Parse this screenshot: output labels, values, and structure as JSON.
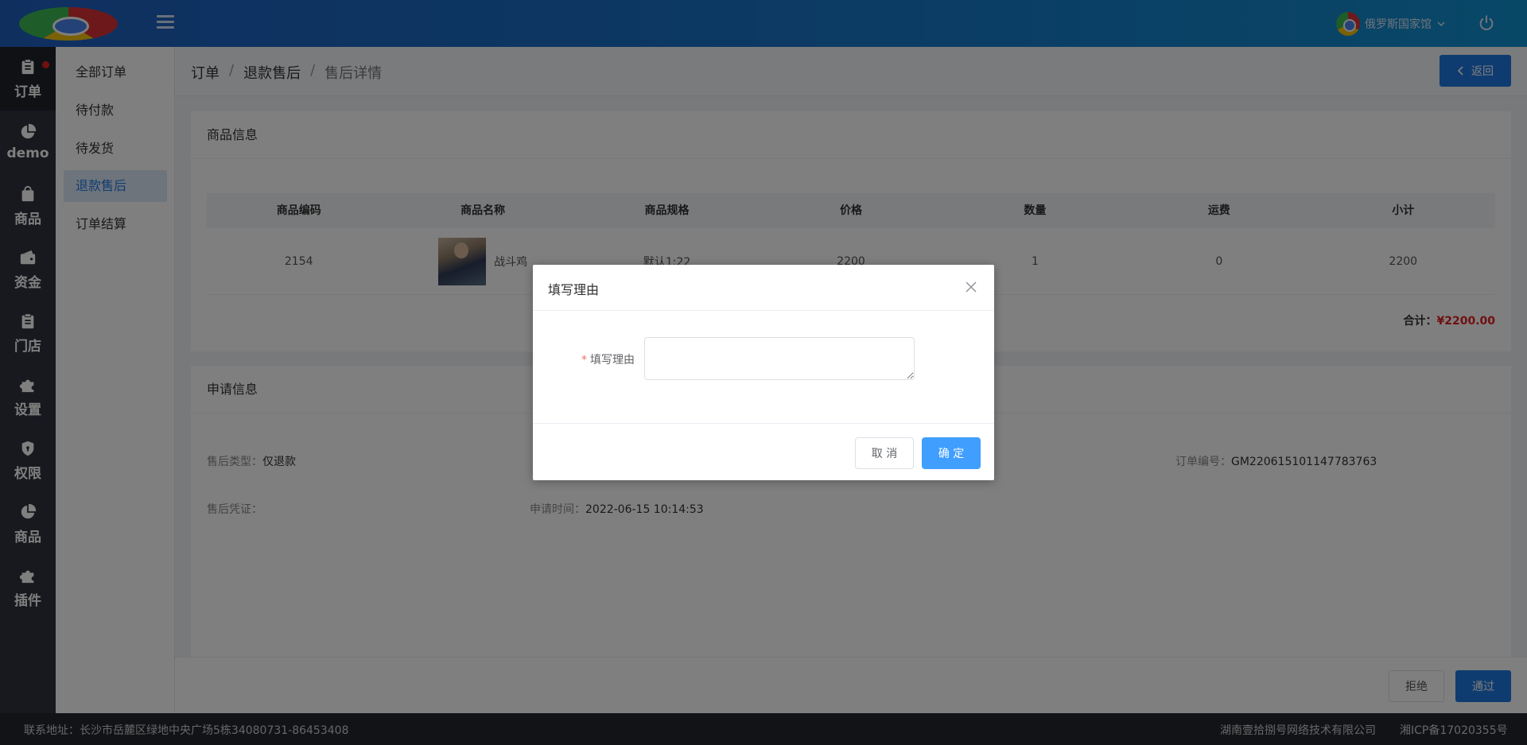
{
  "header": {
    "user_name": "俄罗斯国家馆",
    "menu_icon": "hamburger-icon",
    "power_icon": "power-icon"
  },
  "rail": {
    "items": [
      {
        "label": "订单",
        "icon": "clipboard-icon"
      },
      {
        "label": "demo",
        "icon": "pie-chart-icon"
      },
      {
        "label": "商品",
        "icon": "shopping-bag-icon"
      },
      {
        "label": "资金",
        "icon": "wallet-icon"
      },
      {
        "label": "门店",
        "icon": "clipboard-icon"
      },
      {
        "label": "设置",
        "icon": "puzzle-icon"
      },
      {
        "label": "权限",
        "icon": "shield-icon"
      },
      {
        "label": "商品",
        "icon": "pie-chart-icon"
      },
      {
        "label": "插件",
        "icon": "puzzle-icon"
      }
    ]
  },
  "submenu": {
    "items": [
      {
        "label": "全部订单"
      },
      {
        "label": "待付款"
      },
      {
        "label": "待发货"
      },
      {
        "label": "退款售后"
      },
      {
        "label": "订单结算"
      }
    ]
  },
  "breadcrumb": {
    "items": [
      "订单",
      "退款售后",
      "售后详情"
    ],
    "separator": "/",
    "back_label": "返回"
  },
  "goods": {
    "title": "商品信息",
    "columns": [
      "商品编码",
      "商品名称",
      "商品规格",
      "价格",
      "数量",
      "运费",
      "小计"
    ],
    "row": {
      "code": "2154",
      "name": "战斗鸡",
      "spec": "默认1:22",
      "price": "2200",
      "qty": "1",
      "shipping": "0",
      "subtotal": "2200"
    },
    "total_label": "合计：",
    "total_value": "¥2200.00"
  },
  "apply": {
    "title": "申请信息",
    "type_label": "售后类型：",
    "type_value": "仅退款",
    "order_label": "订单编号：",
    "order_value": "GM220615101147783763",
    "proof_label": "售后凭证：",
    "time_label": "申请时间：",
    "time_value": "2022-06-15 10:14:53"
  },
  "actions": {
    "reject": "拒绝",
    "pass": "通过"
  },
  "footer": {
    "address": "联系地址：长沙市岳麓区绿地中央广场5栋34080731-86453408",
    "company": "湖南壹拾捌号网络技术有限公司",
    "icp": "湘ICP备17020355号"
  },
  "dialog": {
    "title": "填写理由",
    "field_label": "填写理由",
    "field_required_mark": "*",
    "field_value": "",
    "cancel": "取 消",
    "confirm": "确 定"
  },
  "colors": {
    "primary": "#1e78e0",
    "dialog_primary": "#409eff",
    "danger": "#e02020",
    "rail_bg": "#2e333e"
  }
}
